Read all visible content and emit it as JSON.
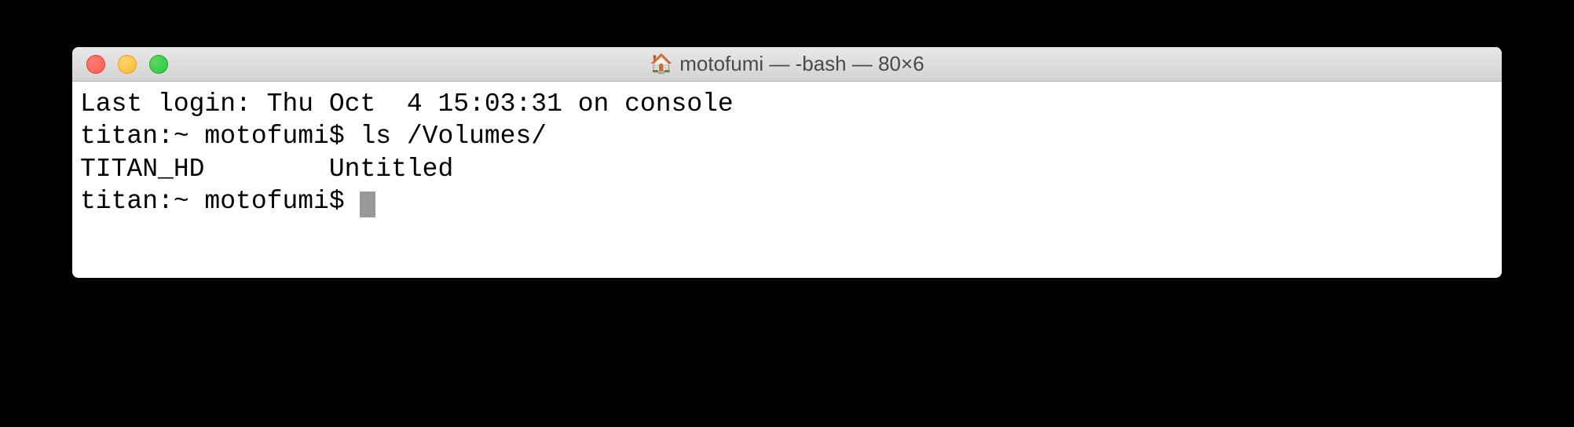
{
  "window": {
    "title": "motofumi — -bash — 80×6"
  },
  "terminal": {
    "line1": "Last login: Thu Oct  4 15:03:31 on console",
    "line2": "titan:~ motofumi$ ls /Volumes/",
    "line3": "TITAN_HD        Untitled",
    "line4_prompt": "titan:~ motofumi$ "
  }
}
